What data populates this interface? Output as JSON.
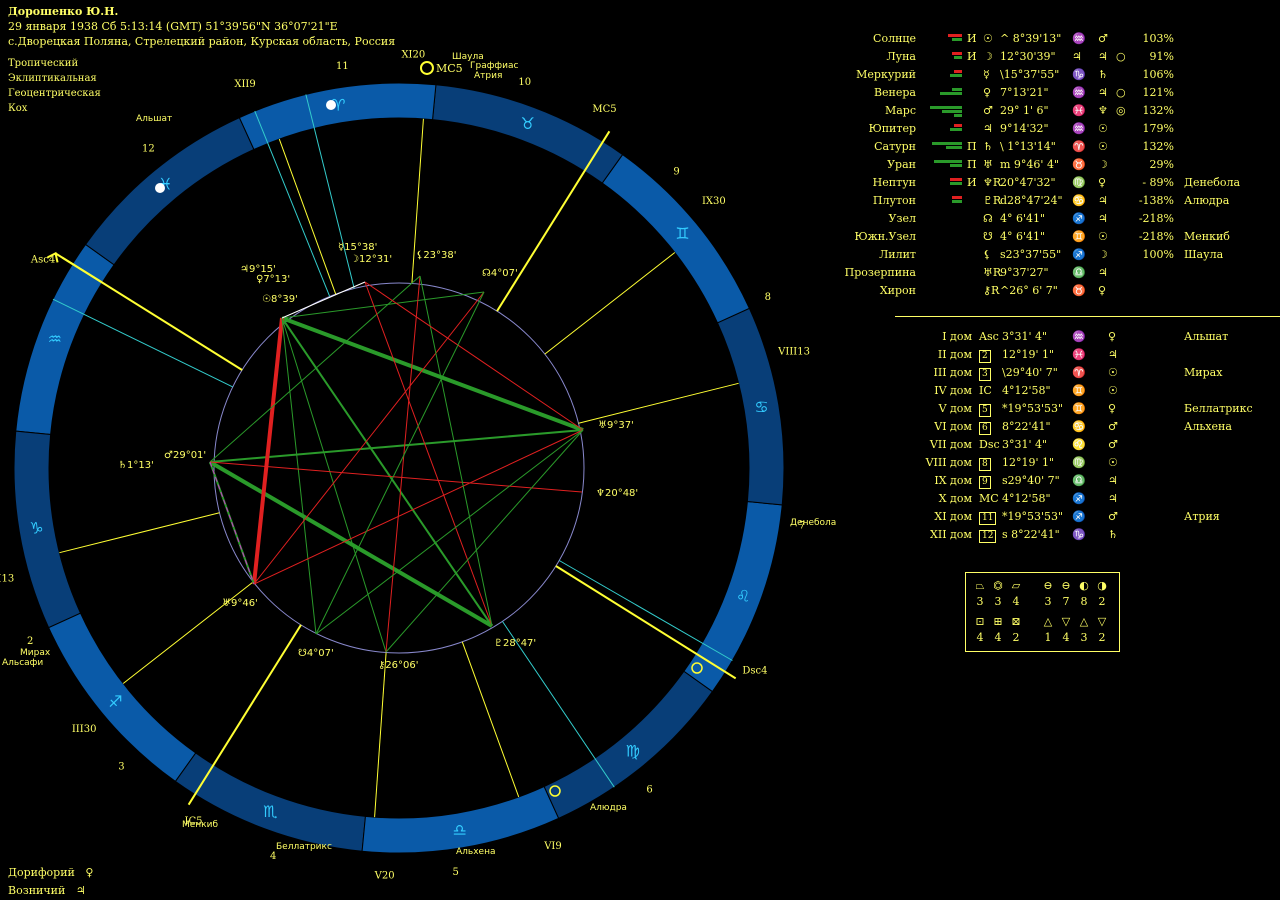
{
  "header": {
    "name": "Дорошенко Ю.Н.",
    "date_line": "29 января 1938  Сб   5:13:14 (GMT) 51°39'56\"N  36°07'21\"E",
    "place_line": "с.Дворецкая Поляна, Стрелецкий район, Курская область, Россия"
  },
  "modes": [
    "Тропический",
    "Эклиптикальная",
    "Геоцентрическая",
    "Кох"
  ],
  "planets": [
    {
      "name": "Солнце",
      "flag": "И",
      "glyph": "☉",
      "pos": "^  8°39'13\"",
      "sign": "♒",
      "ruler": "♂",
      "extra": "",
      "pct": "103%",
      "star": ""
    },
    {
      "name": "Луна",
      "flag": "И",
      "glyph": "☽",
      "pos": "12°30'39\"",
      "sign": "♃",
      "ruler": "♃",
      "extra": "○",
      "pct": "91%",
      "star": ""
    },
    {
      "name": "Меркурий",
      "flag": "",
      "glyph": "☿",
      "pos": "\\15°37'55\"",
      "sign": "♑",
      "ruler": "♄",
      "extra": "",
      "pct": "106%",
      "star": ""
    },
    {
      "name": "Венера",
      "flag": "",
      "glyph": "♀",
      "pos": "7°13'21\"",
      "sign": "♒",
      "ruler": "♃",
      "extra": "○",
      "pct": "121%",
      "star": ""
    },
    {
      "name": "Марс",
      "flag": "",
      "glyph": "♂",
      "pos": "29° 1' 6\"",
      "sign": "♓",
      "ruler": "♆",
      "extra": "◎",
      "pct": "132%",
      "star": ""
    },
    {
      "name": "Юпитер",
      "flag": "",
      "glyph": "♃",
      "pos": "9°14'32\"",
      "sign": "♒",
      "ruler": "☉",
      "extra": "",
      "pct": "179%",
      "star": ""
    },
    {
      "name": "Сатурн",
      "flag": "П",
      "glyph": "♄",
      "pos": "\\ 1°13'14\"",
      "sign": "♈",
      "ruler": "☉",
      "extra": "",
      "pct": "132%",
      "star": ""
    },
    {
      "name": "Уран",
      "flag": "П",
      "glyph": "♅",
      "pos": "m  9°46' 4\"",
      "sign": "♉",
      "ruler": "☽",
      "extra": "",
      "pct": "29%",
      "star": ""
    },
    {
      "name": "Нептун",
      "flag": "И",
      "glyph": "♆R",
      "pos": "20°47'32\"",
      "sign": "♍",
      "ruler": "♀",
      "extra": "",
      "pct": "- 89%",
      "star": "Денебола"
    },
    {
      "name": "Плутон",
      "flag": "",
      "glyph": "♇R",
      "pos": "d28°47'24\"",
      "sign": "♋",
      "ruler": "♃",
      "extra": "",
      "pct": "-138%",
      "star": "Алюдра"
    },
    {
      "name": "Узел",
      "flag": "",
      "glyph": "☊",
      "pos": "4° 6'41\"",
      "sign": "♐",
      "ruler": "♃",
      "extra": "",
      "pct": "-218%",
      "star": ""
    },
    {
      "name": "Южн.Узел",
      "flag": "",
      "glyph": "☋",
      "pos": "4° 6'41\"",
      "sign": "♊",
      "ruler": "☉",
      "extra": "",
      "pct": "-218%",
      "star": "Менкиб"
    },
    {
      "name": "Лилит",
      "flag": "",
      "glyph": "⚸",
      "pos": "s23°37'55\"",
      "sign": "♐",
      "ruler": "☽",
      "extra": "",
      "pct": "100%",
      "star": "Шаула"
    },
    {
      "name": "Прозерпина",
      "flag": "",
      "glyph": "♅R",
      "pos": "9°37'27\"",
      "sign": "♎",
      "ruler": "♃",
      "extra": "",
      "pct": "",
      "star": ""
    },
    {
      "name": "Хирон",
      "flag": "",
      "glyph": "⚷R",
      "pos": "^26° 6' 7\"",
      "sign": "♉",
      "ruler": "♀",
      "extra": "",
      "pct": "",
      "star": ""
    }
  ],
  "houses": [
    {
      "name": "I дом",
      "cusp": "Asc",
      "pos": "3°31' 4\"",
      "sign": "♒",
      "ruler": "♀",
      "star": "Альшат"
    },
    {
      "name": "II дом",
      "cusp": "2",
      "pos": "12°19' 1\"",
      "sign": "♓",
      "ruler": "♃",
      "star": ""
    },
    {
      "name": "III дом",
      "cusp": "3",
      "pos": "\\29°40' 7\"",
      "sign": "♈",
      "ruler": "☉",
      "star": "Мирах"
    },
    {
      "name": "IV дом",
      "cusp": "IC",
      "pos": "4°12'58\"",
      "sign": "♊",
      "ruler": "☉",
      "star": ""
    },
    {
      "name": "V дом",
      "cusp": "5",
      "pos": "*19°53'53\"",
      "sign": "♊",
      "ruler": "♀",
      "star": "Беллатрикс"
    },
    {
      "name": "VI дом",
      "cusp": "6",
      "pos": "8°22'41\"",
      "sign": "♋",
      "ruler": "♂",
      "star": "Альхена"
    },
    {
      "name": "VII дом",
      "cusp": "Dsc",
      "pos": "3°31' 4\"",
      "sign": "♌",
      "ruler": "♂",
      "star": ""
    },
    {
      "name": "VIII дом",
      "cusp": "8",
      "pos": "12°19' 1\"",
      "sign": "♍",
      "ruler": "☉",
      "star": ""
    },
    {
      "name": "IX дом",
      "cusp": "9",
      "pos": "s29°40' 7\"",
      "sign": "♎",
      "ruler": "♃",
      "star": ""
    },
    {
      "name": "X дом",
      "cusp": "MC",
      "pos": "4°12'58\"",
      "sign": "♐",
      "ruler": "♃",
      "star": ""
    },
    {
      "name": "XI дом",
      "cusp": "11",
      "pos": "*19°53'53\"",
      "sign": "♐",
      "ruler": "♂",
      "star": "Атрия"
    },
    {
      "name": "XII дом",
      "cusp": "12",
      "pos": "s  8°22'41\"",
      "sign": "♑",
      "ruler": "♄",
      "star": ""
    }
  ],
  "elements": {
    "row1_syms": [
      "⏢",
      "⏣",
      "⏥",
      "⊖",
      "⊖",
      "◐",
      "◑"
    ],
    "row1_vals": [
      "3",
      "3",
      "4",
      "3",
      "7",
      "8",
      "2"
    ],
    "row2_syms": [
      "⊡",
      "⊞",
      "⊠",
      "△",
      "▽",
      "△",
      "▽"
    ],
    "row2_vals": [
      "4",
      "4",
      "2",
      "1",
      "4",
      "3",
      "2"
    ]
  },
  "footer": [
    {
      "label": "Дорифорий",
      "glyph": "♀"
    },
    {
      "label": "Возничий",
      "glyph": "♃"
    }
  ],
  "wheel": {
    "house_numbers_outer": [
      "12",
      "11",
      "10",
      "9",
      "8",
      "7",
      "6",
      "5",
      "4",
      "3",
      "2",
      "1"
    ],
    "cusp_labels": [
      "Asc4",
      "XII9",
      "XI20",
      "MC5",
      "IX30",
      "VIII13",
      "Dsc4",
      "VI9",
      "V20",
      "IC5",
      "III30",
      "II13"
    ],
    "signs": [
      "♑",
      "♐",
      "♏",
      "♎",
      "♍",
      "♌",
      "♋",
      "♊",
      "♉",
      "♈",
      "♓",
      "♒"
    ],
    "planet_labels": [
      {
        "glyph": "☿",
        "text": "15°38'"
      },
      {
        "glyph": "☽",
        "text": "12°31'"
      },
      {
        "glyph": "⚸",
        "text": "23°38'"
      },
      {
        "glyph": "☊",
        "text": "4°07'"
      },
      {
        "glyph": "♃",
        "text": "9°15'"
      },
      {
        "glyph": "♀",
        "text": "7°13'"
      },
      {
        "glyph": "☉",
        "text": "8°39'"
      },
      {
        "glyph": "♄",
        "text": "1°13'"
      },
      {
        "glyph": "♂",
        "text": "29°01'"
      },
      {
        "glyph": "♅",
        "text": "9°46'"
      },
      {
        "glyph": "☋",
        "text": "4°07'"
      },
      {
        "glyph": "⚷",
        "text": "26°06'"
      },
      {
        "glyph": "♇",
        "text": "28°47'"
      },
      {
        "glyph": "♆",
        "text": "20°48'"
      },
      {
        "glyph": "♅",
        "text": "9°37'"
      }
    ],
    "stars": [
      "Альшат",
      "Шаула",
      "Граффиас",
      "Атрия",
      "Денебола",
      "Алюдра",
      "Альхена",
      "Беллатрикс",
      "Менкиб",
      "Мирах",
      "Альсафи"
    ],
    "colors": {
      "ring": "#0a5aa8",
      "ring_dark": "#083e78",
      "aspect_red": "#e02020",
      "aspect_green": "#2a9a2a",
      "cusp": "#ffff33",
      "cyan": "#33cccc"
    }
  }
}
